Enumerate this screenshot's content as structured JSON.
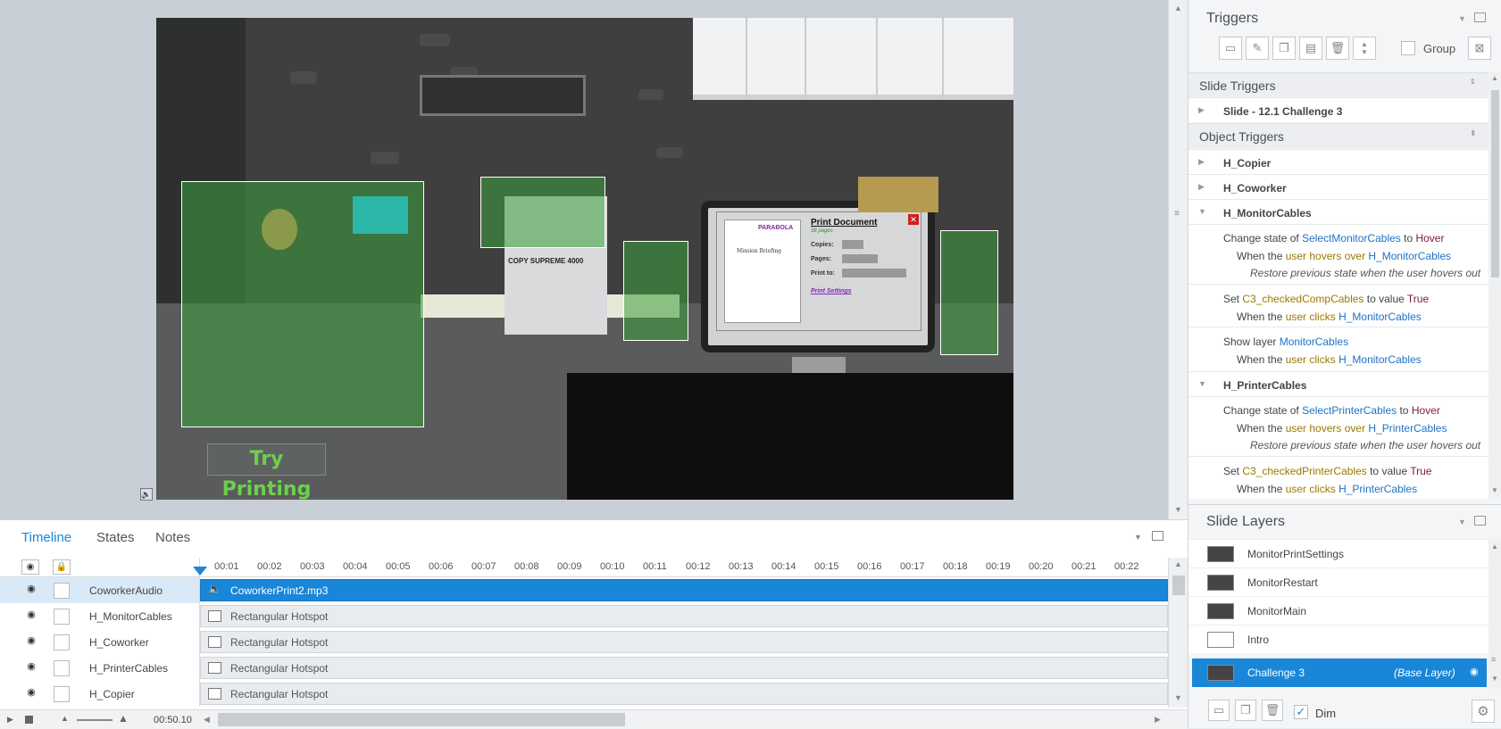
{
  "slide": {
    "copier_label": "COPY SUPREME 4000",
    "try_button": "Try Printing",
    "print_dialog": {
      "title": "Print Document",
      "pages_note": "38 pages",
      "copies": "Copies:",
      "pages": "Pages:",
      "print_to": "Print to:",
      "settings_link": "Print Settings",
      "brand": "PARABOLA",
      "doc_title": "Mission Briefing"
    }
  },
  "triggers": {
    "title": "Triggers",
    "group_label": "Group",
    "slide_triggers_head": "Slide Triggers",
    "slide_item": "Slide - 12.1 Challenge 3",
    "object_triggers_head": "Object Triggers",
    "objects": [
      "H_Copier",
      "H_Coworker",
      "H_MonitorCables",
      "H_PrinterCables"
    ],
    "mc": {
      "t1_a": "Change state of ",
      "t1_b": "SelectMonitorCables",
      "t1_c": " to ",
      "t1_d": "Hover",
      "t1_e": "When the ",
      "t1_f": "user hovers over",
      "t1_g": "H_MonitorCables",
      "t1_h": "Restore previous state when the user hovers out",
      "t2_a": "Set ",
      "t2_b": "C3_checkedCompCables",
      "t2_c": " to value ",
      "t2_d": "True",
      "t2_e": "When the ",
      "t2_f": "user clicks",
      "t2_g": "H_MonitorCables",
      "t3_a": "Show layer ",
      "t3_b": "MonitorCables",
      "t3_e": "When the ",
      "t3_f": "user clicks",
      "t3_g": "H_MonitorCables"
    },
    "pc": {
      "t1_a": "Change state of ",
      "t1_b": "SelectPrinterCables",
      "t1_c": " to ",
      "t1_d": "Hover",
      "t1_e": "When the ",
      "t1_f": "user hovers over",
      "t1_g": "H_PrinterCables",
      "t1_h": "Restore previous state when the user hovers out",
      "t2_a": "Set ",
      "t2_b": "C3_checkedPrinterCables",
      "t2_c": " to value ",
      "t2_d": "True",
      "t2_e": "When the ",
      "t2_f": "user clicks",
      "t2_g": "H_PrinterCables"
    }
  },
  "layers": {
    "title": "Slide Layers",
    "items": [
      "MonitorPrintSettings",
      "MonitorRestart",
      "MonitorMain",
      "Intro"
    ],
    "base": "Challenge 3",
    "base_tag": "(Base Layer)",
    "dim_label": "Dim"
  },
  "timeline": {
    "tabs": [
      "Timeline",
      "States",
      "Notes"
    ],
    "ticks": [
      "00:01",
      "00:02",
      "00:03",
      "00:04",
      "00:05",
      "00:06",
      "00:07",
      "00:08",
      "00:09",
      "00:10",
      "00:11",
      "00:12",
      "00:13",
      "00:14",
      "00:15",
      "00:16",
      "00:17",
      "00:18",
      "00:19",
      "00:20",
      "00:21",
      "00:22"
    ],
    "rows": [
      {
        "name": "CoworkerAudio",
        "track": "CoworkerPrint2.mp3"
      },
      {
        "name": "H_MonitorCables",
        "track": "Rectangular Hotspot"
      },
      {
        "name": "H_Coworker",
        "track": "Rectangular Hotspot"
      },
      {
        "name": "H_PrinterCables",
        "track": "Rectangular Hotspot"
      },
      {
        "name": "H_Copier",
        "track": "Rectangular Hotspot"
      }
    ],
    "duration": "00:50.10"
  },
  "colors": {
    "accent": "#1a86d8",
    "hotspot": "#3ca03c"
  }
}
